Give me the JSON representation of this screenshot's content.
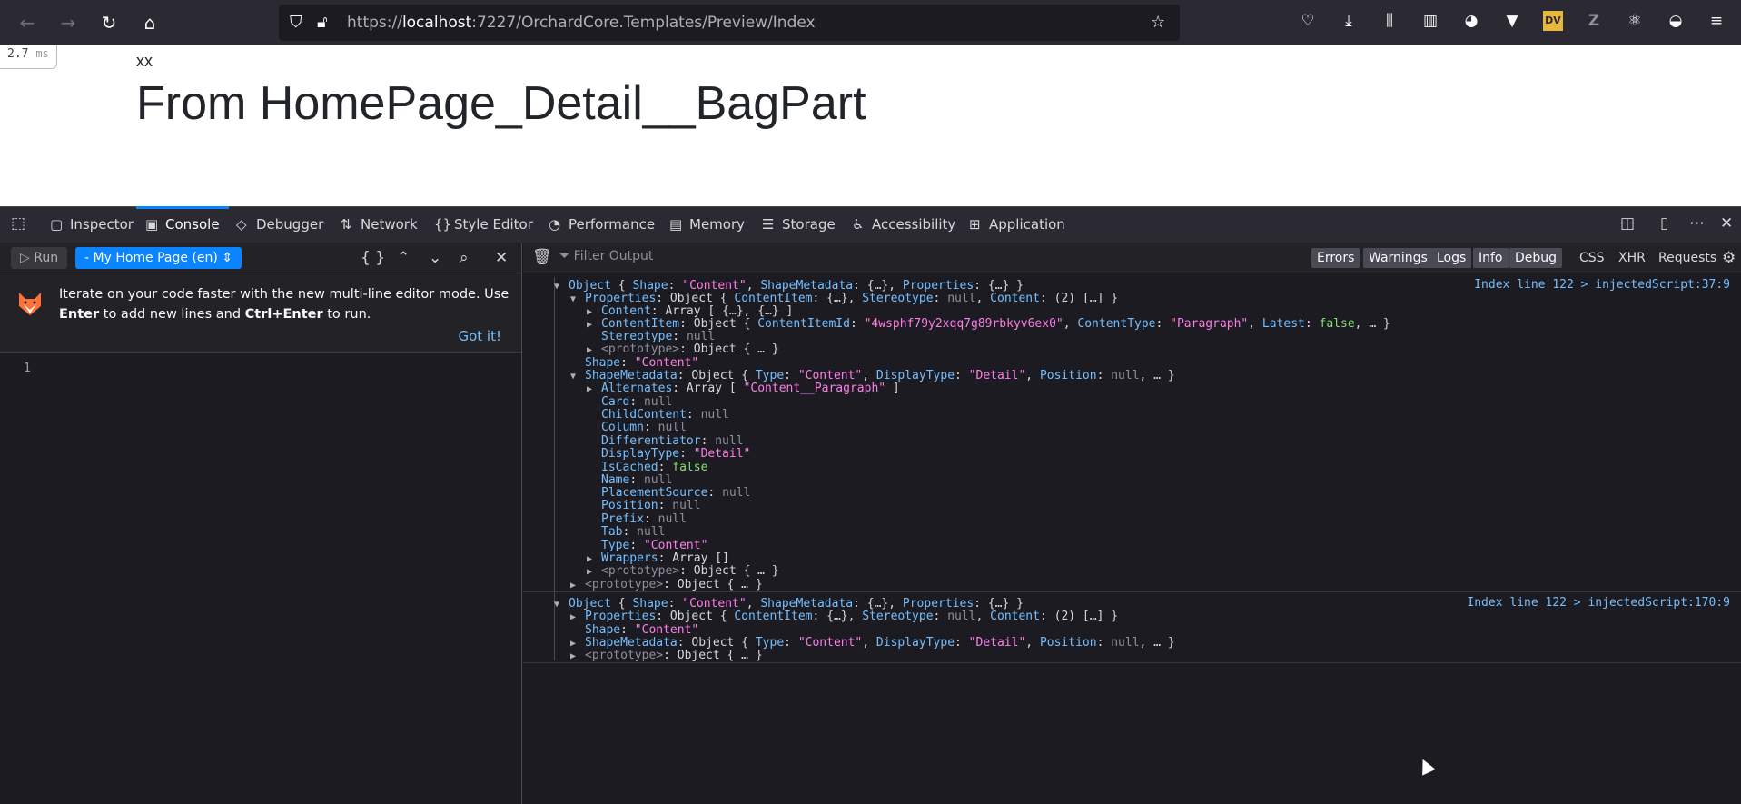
{
  "browser": {
    "url_prefix": "https://",
    "url_host": "localhost",
    "url_rest": ":7227/OrchardCore.Templates/Preview/Index"
  },
  "page": {
    "timer_value": "2.7",
    "timer_unit": "ms",
    "small_text": "xx",
    "title": "From HomePage_Detail__BagPart"
  },
  "devtools": {
    "tabs": [
      {
        "label": "Inspector",
        "icon": "inspector-icon"
      },
      {
        "label": "Console",
        "icon": "console-icon"
      },
      {
        "label": "Debugger",
        "icon": "debugger-icon"
      },
      {
        "label": "Network",
        "icon": "network-icon"
      },
      {
        "label": "Style Editor",
        "icon": "style-editor-icon"
      },
      {
        "label": "Performance",
        "icon": "performance-icon"
      },
      {
        "label": "Memory",
        "icon": "memory-icon"
      },
      {
        "label": "Storage",
        "icon": "storage-icon"
      },
      {
        "label": "Accessibility",
        "icon": "accessibility-icon"
      },
      {
        "label": "Application",
        "icon": "application-icon"
      }
    ],
    "active_tab": "Console"
  },
  "editor": {
    "run_label": "Run",
    "context_label": "- My Home Page (en)",
    "notice_text_1": "Iterate on your code faster with the new multi-line editor mode. Use ",
    "notice_key_1": "Enter",
    "notice_text_2": " to add new lines and ",
    "notice_key_2": "Ctrl+Enter",
    "notice_text_3": " to run.",
    "got_it": "Got it!",
    "line_number": "1"
  },
  "console": {
    "filter_placeholder": "Filter Output",
    "filters": [
      "Errors",
      "Warnings",
      "Logs",
      "Info",
      "Debug"
    ],
    "extra_filters": [
      "CSS",
      "XHR",
      "Requests"
    ],
    "source_1": "Index line 122 > injectedScript:37:9",
    "source_2": "Index line 122 > injectedScript:170:9"
  }
}
